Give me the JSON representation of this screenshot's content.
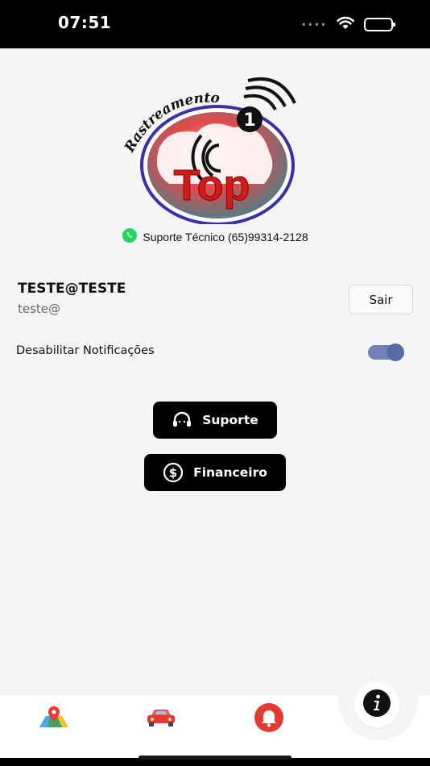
{
  "status_bar": {
    "time": "07:51",
    "icons": [
      "cellular-signal-icon",
      "wifi-icon",
      "battery-icon"
    ]
  },
  "logo": {
    "arc_text": "Rastreamento",
    "main_text": "Top",
    "number": "1",
    "colors": {
      "ring": "#3b2fa8",
      "top_text": "#d21a1a",
      "globe_red": "#e34a4a",
      "globe_teal": "#2a8a96"
    }
  },
  "support": {
    "icon": "whatsapp-icon",
    "text": "Suporte Técnico (65)99314-2128"
  },
  "user": {
    "name": "TESTE@TESTE",
    "email": "teste@"
  },
  "logout_label": "Sair",
  "notifications": {
    "label": "Desabilitar Notificações",
    "enabled": true
  },
  "actions": {
    "support_label": "Suporte",
    "support_icon": "headset-icon",
    "finance_label": "Financeiro",
    "finance_icon": "dollar-circle-icon"
  },
  "tabbar": {
    "tabs": [
      {
        "icon": "map-pin-icon",
        "active": false
      },
      {
        "icon": "car-icon",
        "active": false
      },
      {
        "icon": "bell-icon",
        "active": false
      },
      {
        "icon": "info-icon",
        "active": true
      }
    ]
  }
}
